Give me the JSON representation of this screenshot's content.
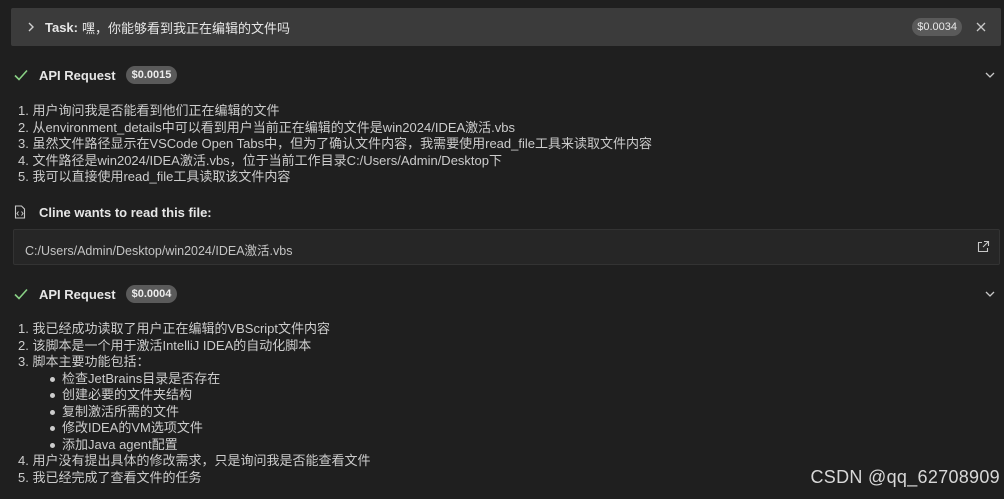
{
  "task": {
    "label": "Task:",
    "text": "嘿，你能够看到我正在编辑的文件吗",
    "cost": "$0.0034"
  },
  "requests": [
    {
      "title": "API Request",
      "cost": "$0.0015",
      "items": [
        "1. 用户询问我是否能看到他们正在编辑的文件",
        "2. 从environment_details中可以看到用户当前正在编辑的文件是win2024/IDEA激活.vbs",
        "3. 虽然文件路径显示在VSCode Open Tabs中，但为了确认文件内容，我需要使用read_file工具来读取文件内容",
        "4. 文件路径是win2024/IDEA激活.vbs，位于当前工作目录C:/Users/Admin/Desktop下",
        "5. 我可以直接使用read_file工具读取该文件内容"
      ]
    },
    {
      "title": "API Request",
      "cost": "$0.0004",
      "items": [
        "1. 我已经成功读取了用户正在编辑的VBScript文件内容",
        "2. 该脚本是一个用于激活IntelliJ IDEA的自动化脚本",
        "3. 脚本主要功能包括："
      ],
      "subitems": [
        "检查JetBrains目录是否存在",
        "创建必要的文件夹结构",
        "复制激活所需的文件",
        "修改IDEA的VM选项文件",
        "添加Java agent配置"
      ],
      "items_after": [
        "4. 用户没有提出具体的修改需求，只是询问我是否能查看文件",
        "5. 我已经完成了查看文件的任务"
      ]
    }
  ],
  "read_file": {
    "title": "Cline wants to read this file:",
    "path": "C:/Users/Admin/Desktop/win2024/IDEA激活.vbs"
  },
  "watermark": "CSDN @qq_62708909",
  "icons": {
    "task_chevron": "chevron-right-icon",
    "close": "close-icon",
    "check": "check-icon",
    "expand": "chevron-down-icon",
    "file_code": "file-code-icon",
    "open": "link-external-icon"
  },
  "colors": {
    "background": "#1f1f1f",
    "task_bar": "#3b3b3b",
    "check_green": "#89d185",
    "badge": "#5a5a5a"
  }
}
